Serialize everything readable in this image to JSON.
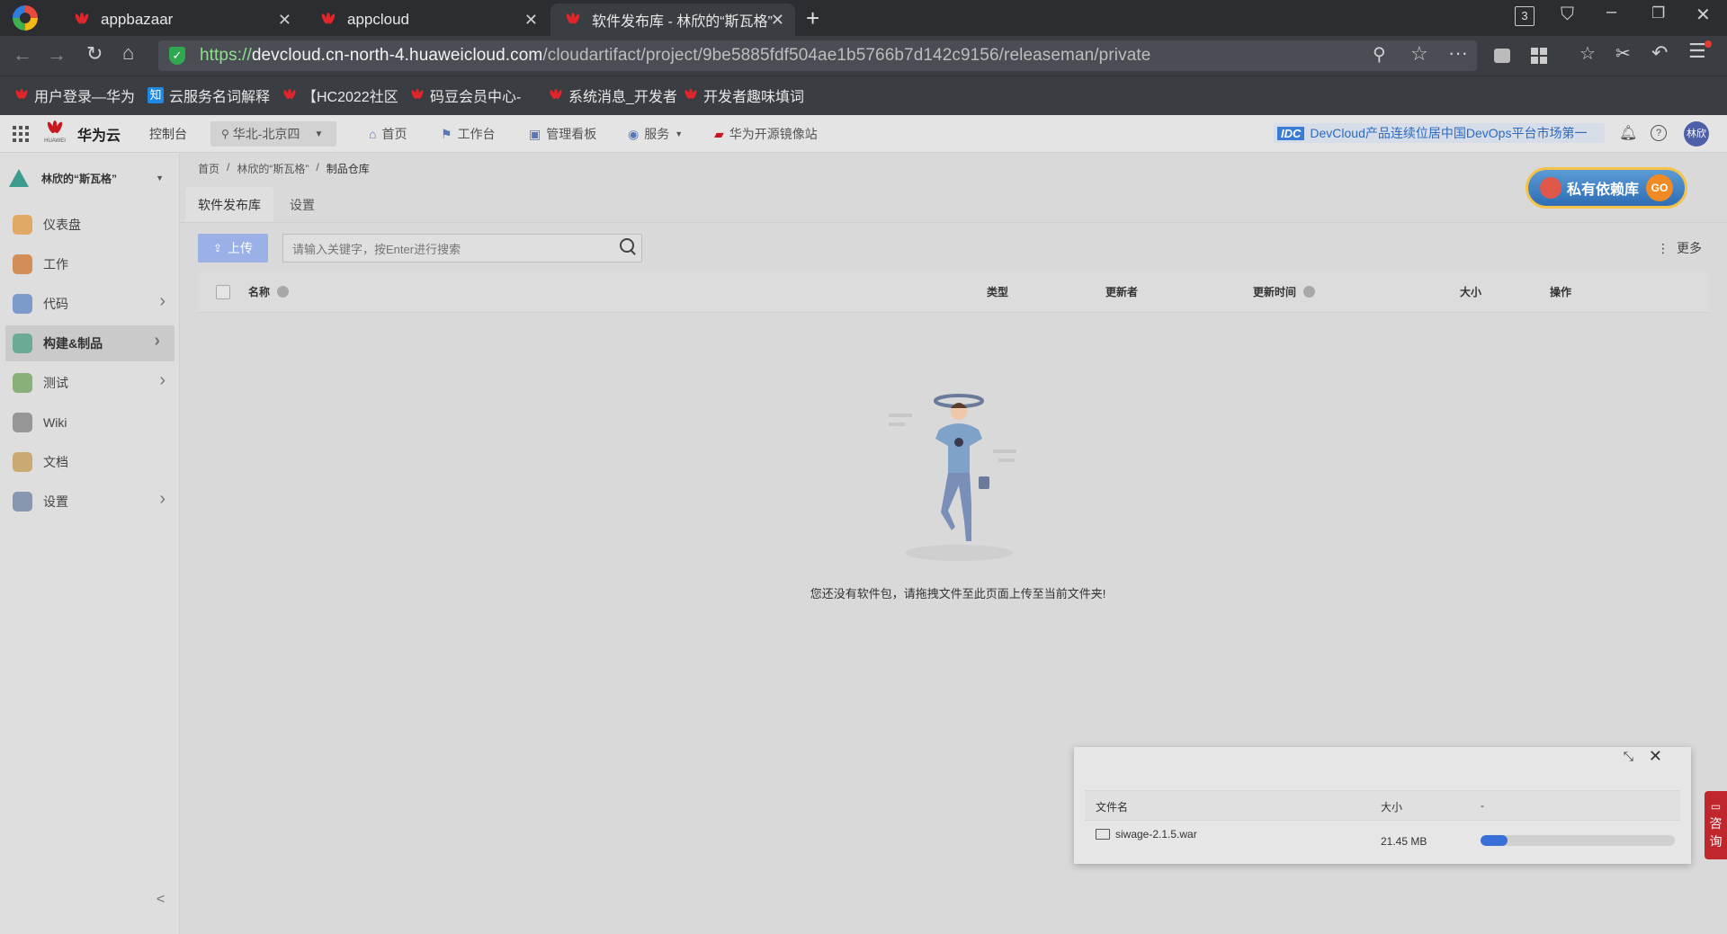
{
  "browser": {
    "tabs": [
      {
        "title": "appbazaar"
      },
      {
        "title": "appcloud"
      },
      {
        "title": "软件发布库 - 林欣的“斯瓦格”",
        "active": true
      }
    ],
    "window_badge": "3",
    "url": {
      "scheme": "https://",
      "host": "devcloud.cn-north-4.huaweicloud.com",
      "path": "/cloudartifact/project/9be5885fdf504ae1b5766b7d142c9156/releaseman/private"
    },
    "bookmarks": [
      {
        "label": "用户登录—华为"
      },
      {
        "label": "云服务名词解释",
        "icon_text": "知"
      },
      {
        "label": "【HC2022社区"
      },
      {
        "label": "码豆会员中心-"
      },
      {
        "label": "系统消息_开发者"
      },
      {
        "label": "开发者趣味填词"
      }
    ]
  },
  "header": {
    "logo_sub": "HUAWEI",
    "brand": "华为云",
    "console": "控制台",
    "region": "华北-北京四",
    "nav": [
      {
        "label": "首页",
        "icon": "home-icon"
      },
      {
        "label": "工作台",
        "icon": "workbench-icon"
      },
      {
        "label": "管理看板",
        "icon": "dashboard-icon"
      },
      {
        "label": "服务",
        "icon": "service-icon"
      },
      {
        "label": "华为开源镜像站",
        "icon": "mirror-icon"
      }
    ],
    "banner_tag": "IDC",
    "banner_text": "DevCloud产品连续位居中国DevOps平台市场第一",
    "avatar": "林欣"
  },
  "sidebar": {
    "project": "林欣的“斯瓦格”",
    "items": [
      {
        "label": "仪表盘",
        "icon": "dashboard-icon",
        "color": "#e0a050",
        "chevron": false
      },
      {
        "label": "工作",
        "icon": "work-icon",
        "color": "#d08040",
        "chevron": false
      },
      {
        "label": "代码",
        "icon": "code-icon",
        "color": "#6b8fc8",
        "chevron": true
      },
      {
        "label": "构建&制品",
        "icon": "build-icon",
        "color": "#5aa58c",
        "chevron": true,
        "active": true
      },
      {
        "label": "测试",
        "icon": "test-icon",
        "color": "#7aa86a",
        "chevron": true
      },
      {
        "label": "Wiki",
        "icon": "wiki-icon",
        "color": "#8a8a8a",
        "chevron": false
      },
      {
        "label": "文档",
        "icon": "doc-icon",
        "color": "#c8a060",
        "chevron": false
      },
      {
        "label": "设置",
        "icon": "settings-icon",
        "color": "#7a8aa8",
        "chevron": true
      }
    ],
    "collapse": "<"
  },
  "main": {
    "breadcrumb": [
      "首页",
      "林欣的“斯瓦格”",
      "制品仓库"
    ],
    "tabs": [
      {
        "label": "软件发布库",
        "active": true
      },
      {
        "label": "设置",
        "active": false
      }
    ],
    "promo": "私有依赖库",
    "promo_go": "GO",
    "upload_label": "上传",
    "search_placeholder": "请输入关键字，按Enter进行搜索",
    "more_label": "更多",
    "table_headers": {
      "name": "名称",
      "type": "类型",
      "updater": "更新者",
      "updated_time": "更新时间",
      "size": "大小",
      "action": "操作"
    },
    "empty_text": "您还没有软件包，请拖拽文件至此页面上传至当前文件夹!"
  },
  "upload_panel": {
    "col_name": "文件名",
    "col_size": "大小",
    "col_extra": "-",
    "file": {
      "name": "siwage-2.1.5.war",
      "size": "21.45 MB",
      "progress": 0.14
    }
  },
  "consult": [
    "咨",
    "询"
  ],
  "colors": {
    "accent": "#3b6fd8",
    "upload_btn": "#9ab0e6",
    "consult": "#c0272d"
  }
}
